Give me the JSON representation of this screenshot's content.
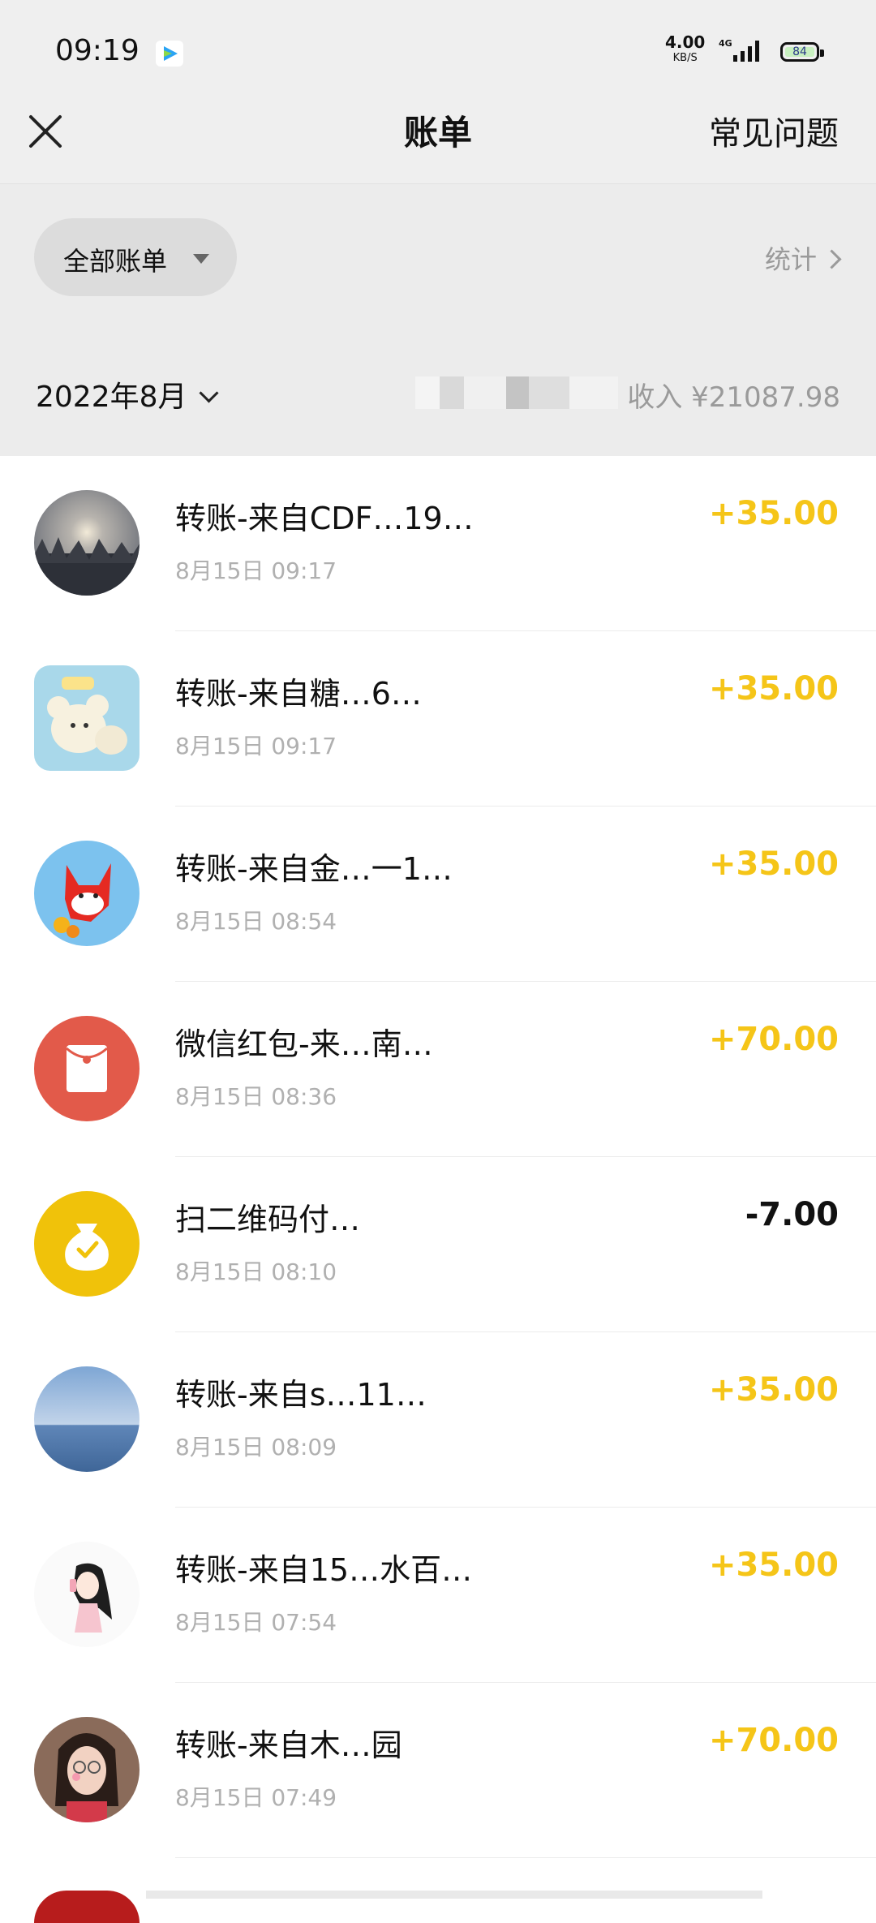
{
  "status_bar": {
    "time": "09:19",
    "net_speed": "4.00",
    "net_unit": "KB/S",
    "network": "4G",
    "battery": "84"
  },
  "nav": {
    "title": "账单",
    "faq": "常见问题"
  },
  "filter": {
    "all_bills": "全部账单",
    "stats": "统计"
  },
  "month": {
    "label": "2022年8月",
    "income": "收入 ¥21087.98"
  },
  "colors": {
    "income_amount": "#f5c518",
    "expense_amount": "#111111",
    "red_packet": "#e25a4a",
    "qr_pay": "#f0c20a"
  },
  "transactions": [
    {
      "title": "转账-来自CDF…19…",
      "date": "8月15日 09:17",
      "amount": "+35.00",
      "avatar": "winter-trees-avatar"
    },
    {
      "title": "转账-来自糖…6…",
      "date": "8月15日 09:17",
      "amount": "+35.00",
      "avatar": "cartoon-mice-avatar"
    },
    {
      "title": "转账-来自金…一1…",
      "date": "8月15日 08:54",
      "amount": "+35.00",
      "avatar": "red-fox-cartoon-avatar"
    },
    {
      "title": "微信红包-来…南…",
      "date": "8月15日 08:36",
      "amount": "+70.00",
      "avatar": "red-packet-icon"
    },
    {
      "title": "扫二维码付…",
      "date": "8月15日 08:10",
      "amount": "-7.00",
      "avatar": "qr-pay-icon"
    },
    {
      "title": "转账-来自s…11…",
      "date": "8月15日 08:09",
      "amount": "+35.00",
      "avatar": "sea-sky-avatar"
    },
    {
      "title": "转账-来自15…水百…",
      "date": "8月15日 07:54",
      "amount": "+35.00",
      "avatar": "girl-drawing-avatar"
    },
    {
      "title": "转账-来自木…园",
      "date": "8月15日 07:49",
      "amount": "+70.00",
      "avatar": "woman-photo-avatar"
    }
  ]
}
